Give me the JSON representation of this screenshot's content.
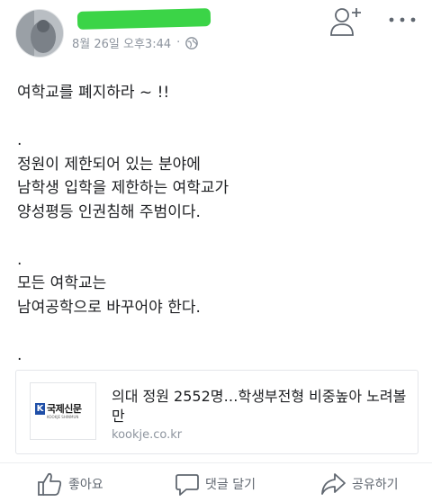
{
  "post": {
    "timestamp": "8월 26일 오후3:44",
    "separator": "·",
    "privacy_icon": "globe-icon",
    "header_actions": {
      "add_friend_icon": "add-friend-icon",
      "more_icon": "more-options-icon"
    },
    "lines": [
      "여학교를 폐지하라 ~ !!",
      "",
      ".",
      "정원이 제한되어 있는 분야에",
      "남학생 입학을 제한하는 여학교가",
      "양성평등 인권침해 주범이다.",
      "",
      ".",
      "모든 여학교는",
      "남여공학으로 바꾸어야 한다.",
      "",
      "."
    ]
  },
  "link_preview": {
    "logo_text": "국제신문",
    "logo_subtext": "KOOKJE SHINMUN",
    "title": "의대 정원 2552명…학생부전형 비중높아 노려볼만",
    "domain": "kookje.co.kr"
  },
  "actions": {
    "like": {
      "label": "좋아요",
      "icon": "thumbs-up-icon"
    },
    "comment": {
      "label": "댓글 달기",
      "icon": "comment-icon"
    },
    "share": {
      "label": "공유하기",
      "icon": "share-icon"
    }
  },
  "colors": {
    "text": "#1c1e21",
    "meta": "#8d949e",
    "action_text": "#606770",
    "name_redaction": "#3bd447",
    "logo_blue": "#1f4fa8"
  }
}
